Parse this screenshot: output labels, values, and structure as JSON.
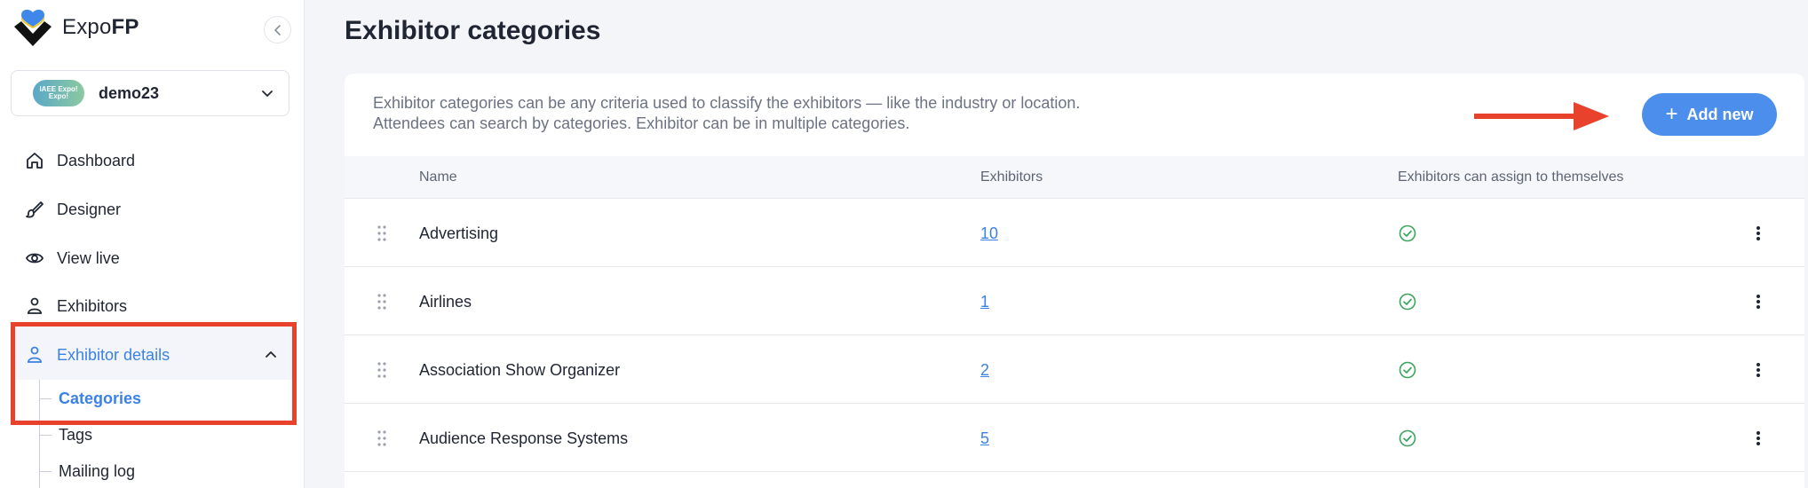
{
  "app": {
    "logo_prefix": "Expo",
    "logo_suffix": "FP",
    "accent": "#3b82e6",
    "highlight": "#e8412c"
  },
  "project": {
    "badge_text": "IAEE Expo! Expo!",
    "name": "demo23"
  },
  "nav": {
    "items": [
      {
        "label": "Dashboard",
        "icon": "home-icon"
      },
      {
        "label": "Designer",
        "icon": "brush-icon"
      },
      {
        "label": "View live",
        "icon": "eye-icon"
      },
      {
        "label": "Exhibitors",
        "icon": "exhibitors-icon"
      },
      {
        "label": "Exhibitor details",
        "icon": "exhibitor-details-icon"
      }
    ],
    "sub_items": [
      {
        "label": "Categories"
      },
      {
        "label": "Tags"
      },
      {
        "label": "Mailing log"
      }
    ]
  },
  "page": {
    "title": "Exhibitor categories",
    "description_line1": "Exhibitor categories can be any criteria used to classify the exhibitors — like the industry or location.",
    "description_line2": "Attendees can search by categories. Exhibitor can be in multiple categories.",
    "add_label": "Add new"
  },
  "table": {
    "columns": [
      "Name",
      "Exhibitors",
      "Exhibitors can assign to themselves"
    ],
    "rows": [
      {
        "name": "Advertising",
        "exhibitors": "10",
        "self_assign": true
      },
      {
        "name": "Airlines",
        "exhibitors": "1",
        "self_assign": true
      },
      {
        "name": "Association Show Organizer",
        "exhibitors": "2",
        "self_assign": true
      },
      {
        "name": "Audience Response Systems",
        "exhibitors": "5",
        "self_assign": true
      }
    ]
  }
}
